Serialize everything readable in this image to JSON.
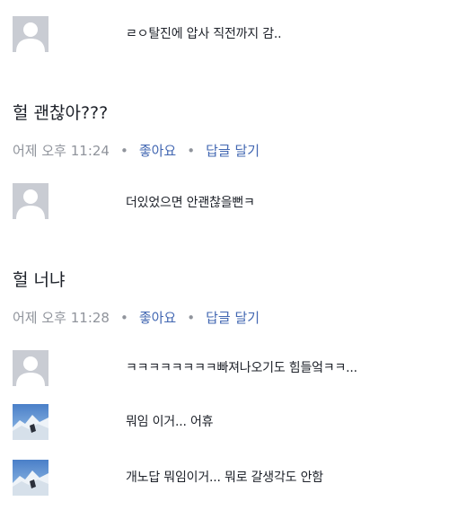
{
  "thread": [
    {
      "kind": "reply",
      "avatar": "default-avatar-icon",
      "text": "ㄹㅇ탈진에 압사 직전까지 감.."
    },
    {
      "kind": "comment",
      "text": "헐 괜찮아???",
      "time": "어제 오후 11:24",
      "like_label": "좋아요",
      "reply_label": "답글 달기"
    },
    {
      "kind": "reply",
      "avatar": "default-avatar-icon",
      "text": "더있었으면 안괜찮을뻔ㅋ"
    },
    {
      "kind": "comment",
      "text": "헐 너냐",
      "time": "어제 오후 11:28",
      "like_label": "좋아요",
      "reply_label": "답글 달기"
    },
    {
      "kind": "reply",
      "avatar": "default-avatar-icon",
      "text": "ㅋㅋㅋㅋㅋㅋㅋㅋ빠져나오기도 힘들엌ㅋㅋ..."
    },
    {
      "kind": "reply",
      "avatar": "snow-mountain-photo-avatar",
      "text": "뭐임 이거... 어휴"
    },
    {
      "kind": "reply",
      "avatar": "snow-mountain-photo-avatar",
      "text": "개노답 뭐임이거... 뭐로 갈생각도 안함"
    }
  ],
  "separator": "•",
  "colors": {
    "link": "#4267b2",
    "meta": "#90949c",
    "text": "#1d2129",
    "avatar_bg": "#c9ccd3"
  }
}
